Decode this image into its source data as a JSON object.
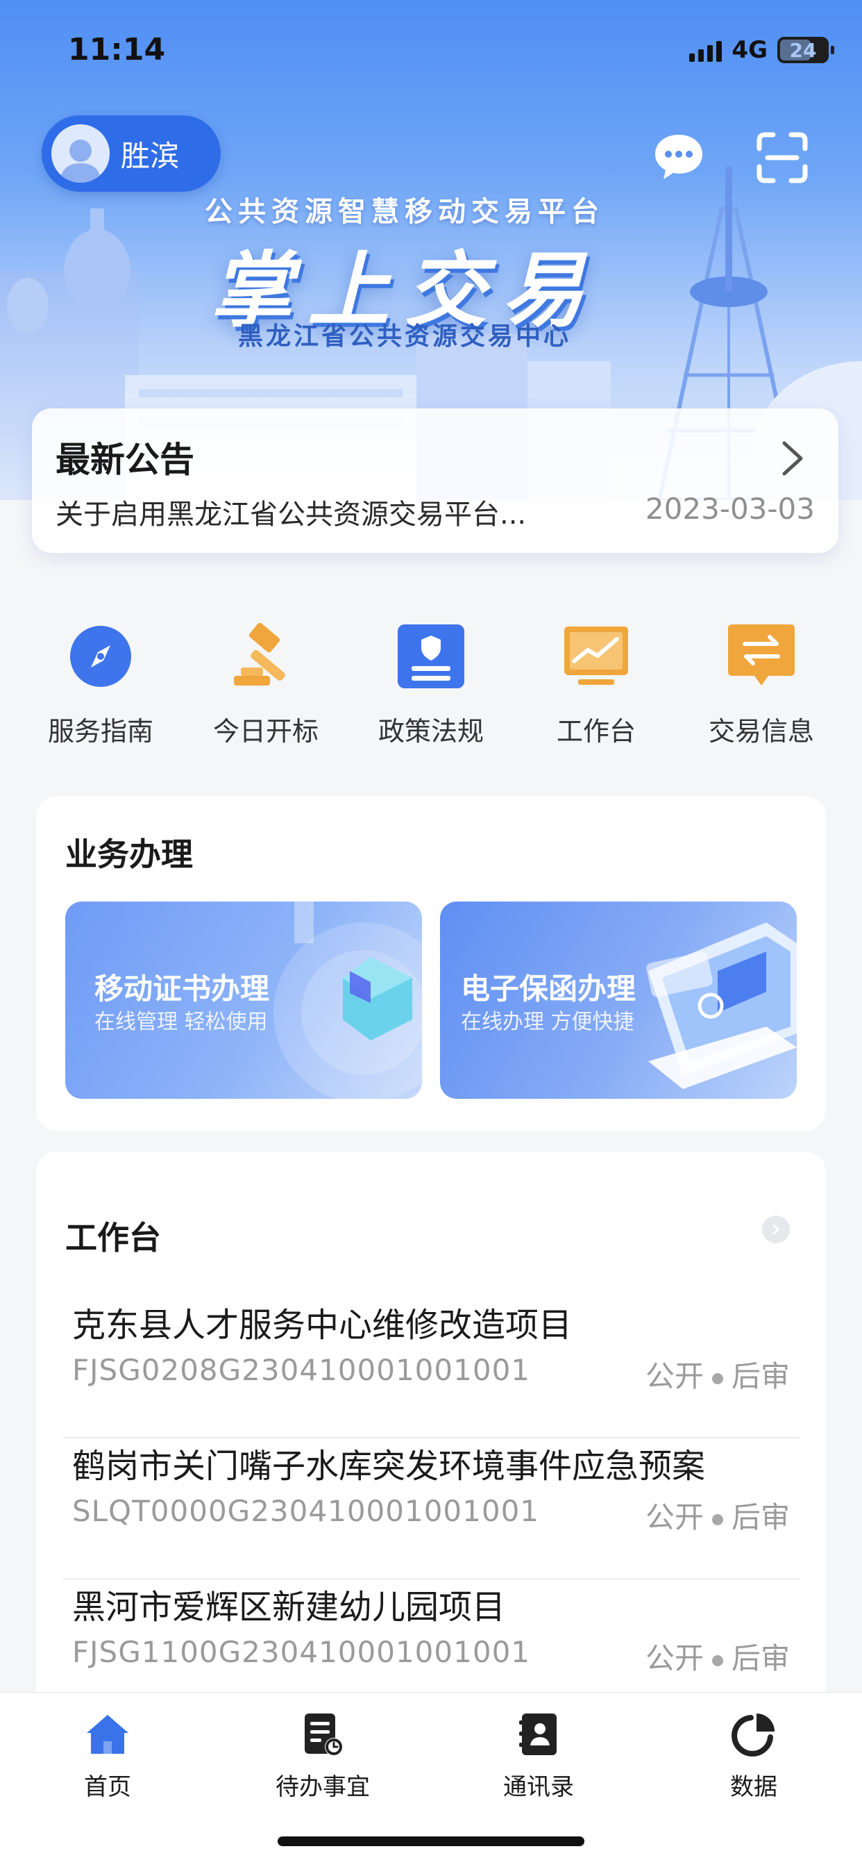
{
  "status_bar": {
    "time": "11:14",
    "network": "4G",
    "battery": "24"
  },
  "user": {
    "name": "胜滨"
  },
  "hero": {
    "subtitle": "公共资源智慧移动交易平台",
    "title": "掌上交易",
    "org": "黑龙江省公共资源交易中心"
  },
  "notice": {
    "title": "最新公告",
    "text": "关于启用黑龙江省公共资源交易平台...",
    "date": "2023-03-03"
  },
  "quick": [
    {
      "label": "服务指南",
      "icon": "compass-icon"
    },
    {
      "label": "今日开标",
      "icon": "gavel-icon"
    },
    {
      "label": "政策法规",
      "icon": "policy-badge-icon"
    },
    {
      "label": "工作台",
      "icon": "chart-board-icon"
    },
    {
      "label": "交易信息",
      "icon": "exchange-icon"
    }
  ],
  "business": {
    "title": "业务办理",
    "tiles": [
      {
        "title": "移动证书办理",
        "subtitle": "在线管理 轻松使用"
      },
      {
        "title": "电子保函办理",
        "subtitle": "在线办理 方便快捷"
      }
    ]
  },
  "workbench": {
    "title": "工作台",
    "items": [
      {
        "title": "克东县人才服务中心维修改造项目",
        "code": "FJSG0208G230410001001001",
        "tag1": "公开",
        "tag2": "后审"
      },
      {
        "title": "鹤岗市关门嘴子水库突发环境事件应急预案",
        "code": "SLQT0000G230410001001001",
        "tag1": "公开",
        "tag2": "后审"
      },
      {
        "title": "黑河市爱辉区新建幼儿园项目",
        "code": "FJSG1100G230410001001001",
        "tag1": "公开",
        "tag2": "后审"
      }
    ]
  },
  "tabbar": [
    {
      "label": "首页",
      "icon": "home-icon",
      "active": true
    },
    {
      "label": "待办事宜",
      "icon": "todo-doc-icon",
      "active": false
    },
    {
      "label": "通讯录",
      "icon": "contacts-icon",
      "active": false
    },
    {
      "label": "数据",
      "icon": "pie-chart-icon",
      "active": false
    }
  ],
  "colors": {
    "primary": "#3a72ea",
    "orange": "#f0a63c",
    "text": "#1a1a1a",
    "muted": "#9a9a9a"
  }
}
